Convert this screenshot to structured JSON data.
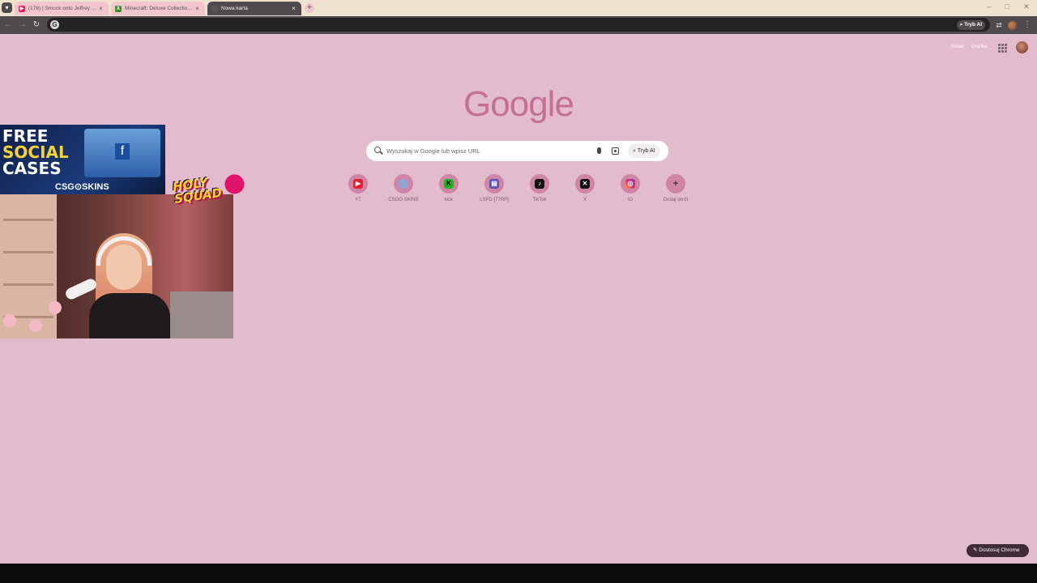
{
  "tabs": [
    {
      "title": "(178) | Smuck onto Jeffrey Epstei...",
      "favicon": "youtube-icon",
      "color": "#e0245e",
      "active": false
    },
    {
      "title": "Minecraft: Deluxe Collection - Xb...",
      "favicon": "xbox-icon",
      "color": "#3a8e28",
      "active": false
    },
    {
      "title": "Nowa karta",
      "favicon": "chrome-icon",
      "color": "#5a5458",
      "active": true
    }
  ],
  "toolbar": {
    "ai_mode_label": "Tryb AI"
  },
  "header_links": {
    "gmail": "Gmail",
    "images": "Grafika"
  },
  "logo": "Google",
  "search": {
    "placeholder": "Wyszukaj w Google lub wpisz URL",
    "ai_mode_label": "Tryb AI"
  },
  "shortcuts": [
    {
      "label": "YT",
      "icon": "youtube-icon",
      "glyph": "▶",
      "color": "#e5202e"
    },
    {
      "label": "CSGO SKINS",
      "icon": "csgo-skins-icon",
      "glyph": "◉",
      "color": "#8aa7d8"
    },
    {
      "label": "kick",
      "icon": "kick-icon",
      "glyph": "K",
      "color": "#1fb51f"
    },
    {
      "label": "LSPD [77RP]",
      "icon": "lspd-icon",
      "glyph": "▤",
      "color": "#5b4fb8"
    },
    {
      "label": "TikTok",
      "icon": "tiktok-icon",
      "glyph": "♪",
      "color": "#111111"
    },
    {
      "label": "X",
      "icon": "x-icon",
      "glyph": "𝕏",
      "color": "#111111"
    },
    {
      "label": "IG",
      "icon": "instagram-icon",
      "glyph": "◎",
      "color": "#d6317a"
    },
    {
      "label": "Dodaj skrót",
      "icon": "plus-icon",
      "glyph": "+",
      "color": "#cf86a6"
    }
  ],
  "customize_label": "Dostosuj Chrome",
  "overlay": {
    "ad_line1": "FREE",
    "ad_line2": "SOCIAL",
    "ad_line3": "CASES",
    "ad_brand": "CSG⊙SKINS",
    "badge_text": "HOLY SQUAD"
  }
}
